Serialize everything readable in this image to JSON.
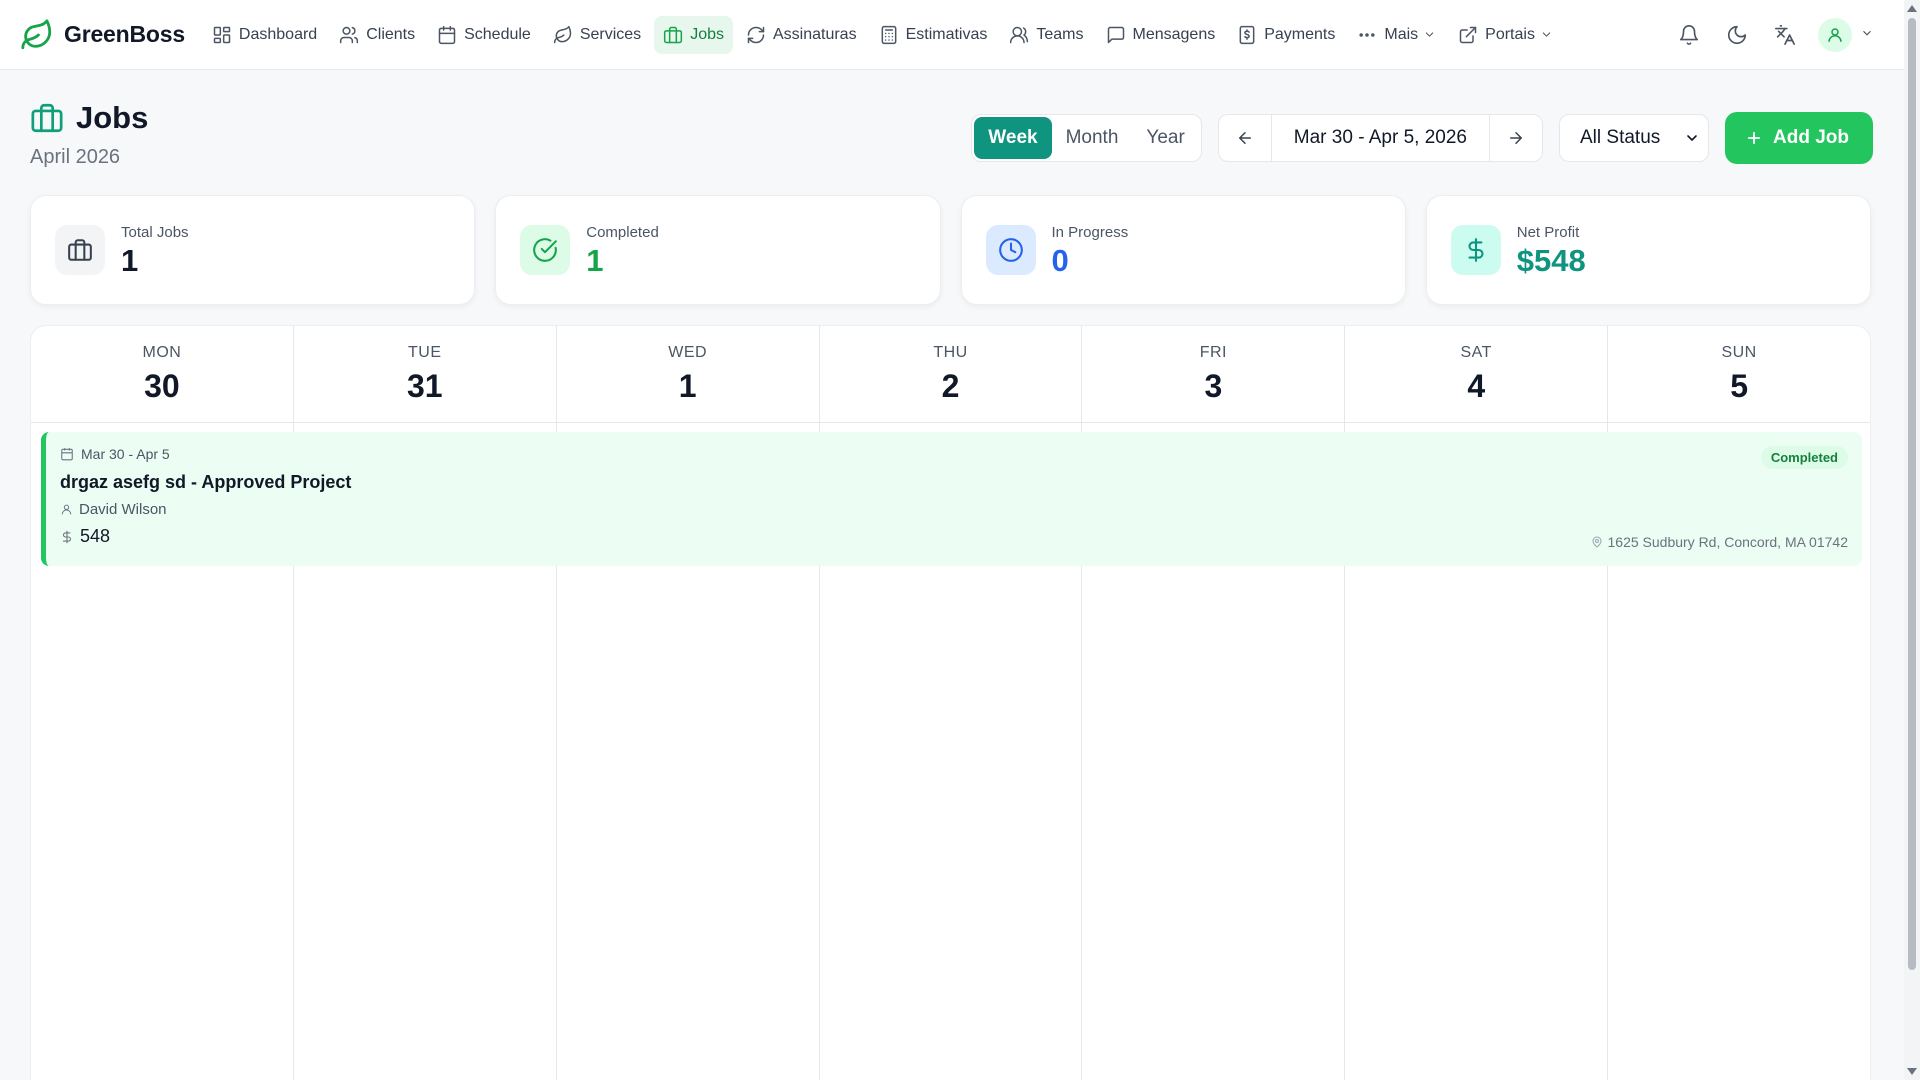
{
  "brand": {
    "name": "GreenBoss",
    "color": "#16a34a"
  },
  "nav": {
    "items": [
      {
        "label": "Dashboard",
        "icon": "grid-icon"
      },
      {
        "label": "Clients",
        "icon": "users-icon"
      },
      {
        "label": "Schedule",
        "icon": "calendar-icon"
      },
      {
        "label": "Services",
        "icon": "leaf-icon"
      },
      {
        "label": "Jobs",
        "icon": "briefcase-icon",
        "active": true
      },
      {
        "label": "Assinaturas",
        "icon": "refresh-icon"
      },
      {
        "label": "Estimativas",
        "icon": "calculator-icon"
      },
      {
        "label": "Teams",
        "icon": "team-icon"
      },
      {
        "label": "Mensagens",
        "icon": "message-icon"
      },
      {
        "label": "Payments",
        "icon": "receipt-icon"
      },
      {
        "label": "Mais",
        "icon": "more-icon"
      },
      {
        "label": "Portais",
        "icon": "external-link-icon"
      }
    ]
  },
  "header": {
    "title": "Jobs",
    "subtitle": "April 2026"
  },
  "view_toggle": {
    "week": "Week",
    "month": "Month",
    "year": "Year",
    "active": "Week"
  },
  "date_range": "Mar 30 - Apr 5, 2026",
  "status_filter": {
    "selected": "All Status"
  },
  "add_button": "Add Job",
  "stats": {
    "total": {
      "label": "Total Jobs",
      "value": "1",
      "color": "#111827"
    },
    "completed": {
      "label": "Completed",
      "value": "1",
      "color": "#16a34a"
    },
    "in_progress": {
      "label": "In Progress",
      "value": "0",
      "color": "#2563eb"
    },
    "net_profit": {
      "label": "Net Profit",
      "value": "$548",
      "color": "#0f9480"
    }
  },
  "calendar": {
    "days": [
      {
        "name": "MON",
        "num": "30"
      },
      {
        "name": "TUE",
        "num": "31"
      },
      {
        "name": "WED",
        "num": "1"
      },
      {
        "name": "THU",
        "num": "2"
      },
      {
        "name": "FRI",
        "num": "3"
      },
      {
        "name": "SAT",
        "num": "4"
      },
      {
        "name": "SUN",
        "num": "5"
      }
    ]
  },
  "job": {
    "date": "Mar 30 - Apr 5",
    "title": "drgaz asefg sd - Approved Project",
    "client": "David Wilson",
    "amount": "548",
    "status": "Completed",
    "address": "1625 Sudbury Rd, Concord, MA 01742"
  }
}
